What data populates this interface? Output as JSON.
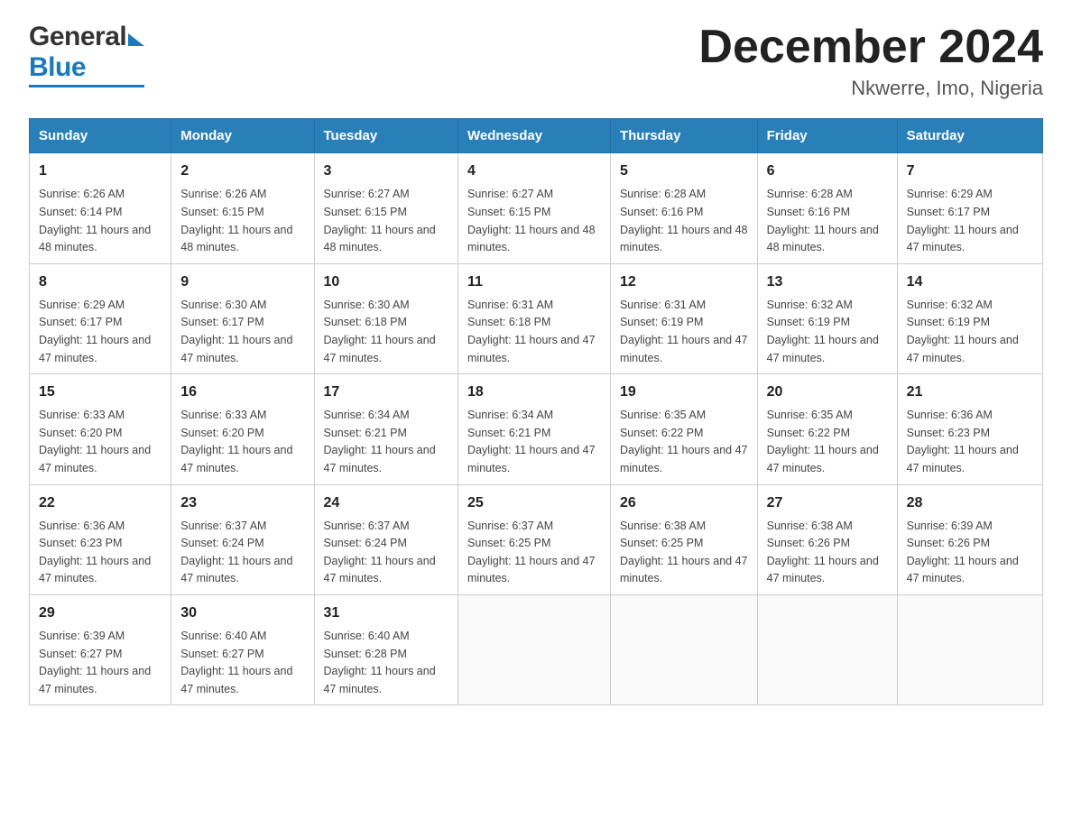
{
  "logo": {
    "general": "General",
    "blue": "Blue"
  },
  "header": {
    "title": "December 2024",
    "subtitle": "Nkwerre, Imo, Nigeria"
  },
  "days": [
    "Sunday",
    "Monday",
    "Tuesday",
    "Wednesday",
    "Thursday",
    "Friday",
    "Saturday"
  ],
  "weeks": [
    [
      {
        "day": "1",
        "sunrise": "6:26 AM",
        "sunset": "6:14 PM",
        "daylight": "11 hours and 48 minutes."
      },
      {
        "day": "2",
        "sunrise": "6:26 AM",
        "sunset": "6:15 PM",
        "daylight": "11 hours and 48 minutes."
      },
      {
        "day": "3",
        "sunrise": "6:27 AM",
        "sunset": "6:15 PM",
        "daylight": "11 hours and 48 minutes."
      },
      {
        "day": "4",
        "sunrise": "6:27 AM",
        "sunset": "6:15 PM",
        "daylight": "11 hours and 48 minutes."
      },
      {
        "day": "5",
        "sunrise": "6:28 AM",
        "sunset": "6:16 PM",
        "daylight": "11 hours and 48 minutes."
      },
      {
        "day": "6",
        "sunrise": "6:28 AM",
        "sunset": "6:16 PM",
        "daylight": "11 hours and 48 minutes."
      },
      {
        "day": "7",
        "sunrise": "6:29 AM",
        "sunset": "6:17 PM",
        "daylight": "11 hours and 47 minutes."
      }
    ],
    [
      {
        "day": "8",
        "sunrise": "6:29 AM",
        "sunset": "6:17 PM",
        "daylight": "11 hours and 47 minutes."
      },
      {
        "day": "9",
        "sunrise": "6:30 AM",
        "sunset": "6:17 PM",
        "daylight": "11 hours and 47 minutes."
      },
      {
        "day": "10",
        "sunrise": "6:30 AM",
        "sunset": "6:18 PM",
        "daylight": "11 hours and 47 minutes."
      },
      {
        "day": "11",
        "sunrise": "6:31 AM",
        "sunset": "6:18 PM",
        "daylight": "11 hours and 47 minutes."
      },
      {
        "day": "12",
        "sunrise": "6:31 AM",
        "sunset": "6:19 PM",
        "daylight": "11 hours and 47 minutes."
      },
      {
        "day": "13",
        "sunrise": "6:32 AM",
        "sunset": "6:19 PM",
        "daylight": "11 hours and 47 minutes."
      },
      {
        "day": "14",
        "sunrise": "6:32 AM",
        "sunset": "6:19 PM",
        "daylight": "11 hours and 47 minutes."
      }
    ],
    [
      {
        "day": "15",
        "sunrise": "6:33 AM",
        "sunset": "6:20 PM",
        "daylight": "11 hours and 47 minutes."
      },
      {
        "day": "16",
        "sunrise": "6:33 AM",
        "sunset": "6:20 PM",
        "daylight": "11 hours and 47 minutes."
      },
      {
        "day": "17",
        "sunrise": "6:34 AM",
        "sunset": "6:21 PM",
        "daylight": "11 hours and 47 minutes."
      },
      {
        "day": "18",
        "sunrise": "6:34 AM",
        "sunset": "6:21 PM",
        "daylight": "11 hours and 47 minutes."
      },
      {
        "day": "19",
        "sunrise": "6:35 AM",
        "sunset": "6:22 PM",
        "daylight": "11 hours and 47 minutes."
      },
      {
        "day": "20",
        "sunrise": "6:35 AM",
        "sunset": "6:22 PM",
        "daylight": "11 hours and 47 minutes."
      },
      {
        "day": "21",
        "sunrise": "6:36 AM",
        "sunset": "6:23 PM",
        "daylight": "11 hours and 47 minutes."
      }
    ],
    [
      {
        "day": "22",
        "sunrise": "6:36 AM",
        "sunset": "6:23 PM",
        "daylight": "11 hours and 47 minutes."
      },
      {
        "day": "23",
        "sunrise": "6:37 AM",
        "sunset": "6:24 PM",
        "daylight": "11 hours and 47 minutes."
      },
      {
        "day": "24",
        "sunrise": "6:37 AM",
        "sunset": "6:24 PM",
        "daylight": "11 hours and 47 minutes."
      },
      {
        "day": "25",
        "sunrise": "6:37 AM",
        "sunset": "6:25 PM",
        "daylight": "11 hours and 47 minutes."
      },
      {
        "day": "26",
        "sunrise": "6:38 AM",
        "sunset": "6:25 PM",
        "daylight": "11 hours and 47 minutes."
      },
      {
        "day": "27",
        "sunrise": "6:38 AM",
        "sunset": "6:26 PM",
        "daylight": "11 hours and 47 minutes."
      },
      {
        "day": "28",
        "sunrise": "6:39 AM",
        "sunset": "6:26 PM",
        "daylight": "11 hours and 47 minutes."
      }
    ],
    [
      {
        "day": "29",
        "sunrise": "6:39 AM",
        "sunset": "6:27 PM",
        "daylight": "11 hours and 47 minutes."
      },
      {
        "day": "30",
        "sunrise": "6:40 AM",
        "sunset": "6:27 PM",
        "daylight": "11 hours and 47 minutes."
      },
      {
        "day": "31",
        "sunrise": "6:40 AM",
        "sunset": "6:28 PM",
        "daylight": "11 hours and 47 minutes."
      },
      null,
      null,
      null,
      null
    ]
  ],
  "labels": {
    "sunrise": "Sunrise:",
    "sunset": "Sunset:",
    "daylight": "Daylight:"
  }
}
